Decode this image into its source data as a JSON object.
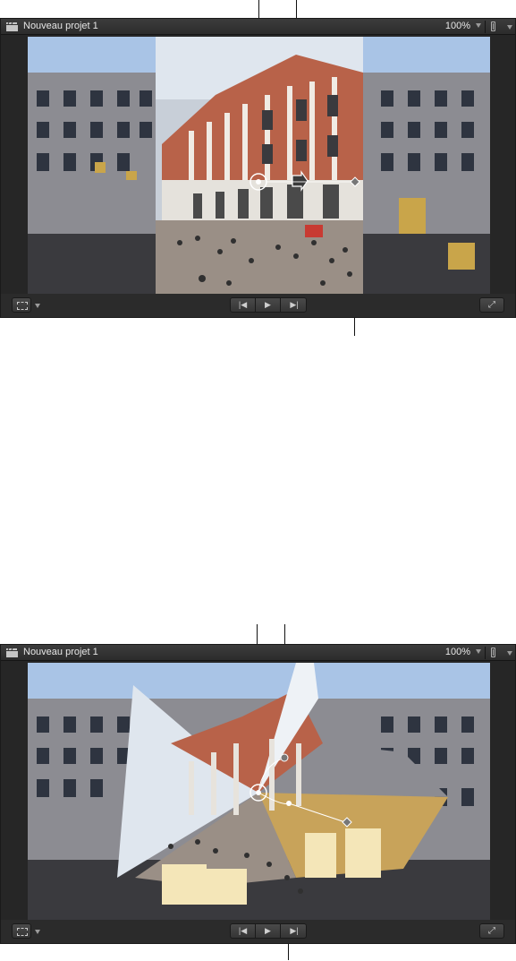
{
  "views": [
    {
      "title": "Nouveau projet 1",
      "zoom": "100%",
      "transport": {
        "prev_label": "Previous frame",
        "play_label": "Play",
        "next_label": "Next frame"
      }
    },
    {
      "title": "Nouveau projet 1",
      "zoom": "100%",
      "transport": {
        "prev_label": "Previous frame",
        "play_label": "Play",
        "next_label": "Next frame"
      }
    }
  ],
  "icons": {
    "transform": "transform-icon",
    "clapper": "clapperboard-icon",
    "view_options": "view-options-icon",
    "prev": "skip-back-icon",
    "play": "play-icon",
    "next": "skip-forward-icon",
    "fullscreen": "fullscreen-icon",
    "center_handle": "center-crosshair-icon",
    "rotation_handle": "rotation-arrow-icon",
    "edge_handle": "diamond-handle-icon"
  },
  "colors": {
    "viewer_bg": "#262626",
    "titlebar": "#343434",
    "sky": "#a9c4e6",
    "building": "#8c8c92",
    "brick": "#b86249",
    "onscreen_handle": "#ffffff"
  }
}
